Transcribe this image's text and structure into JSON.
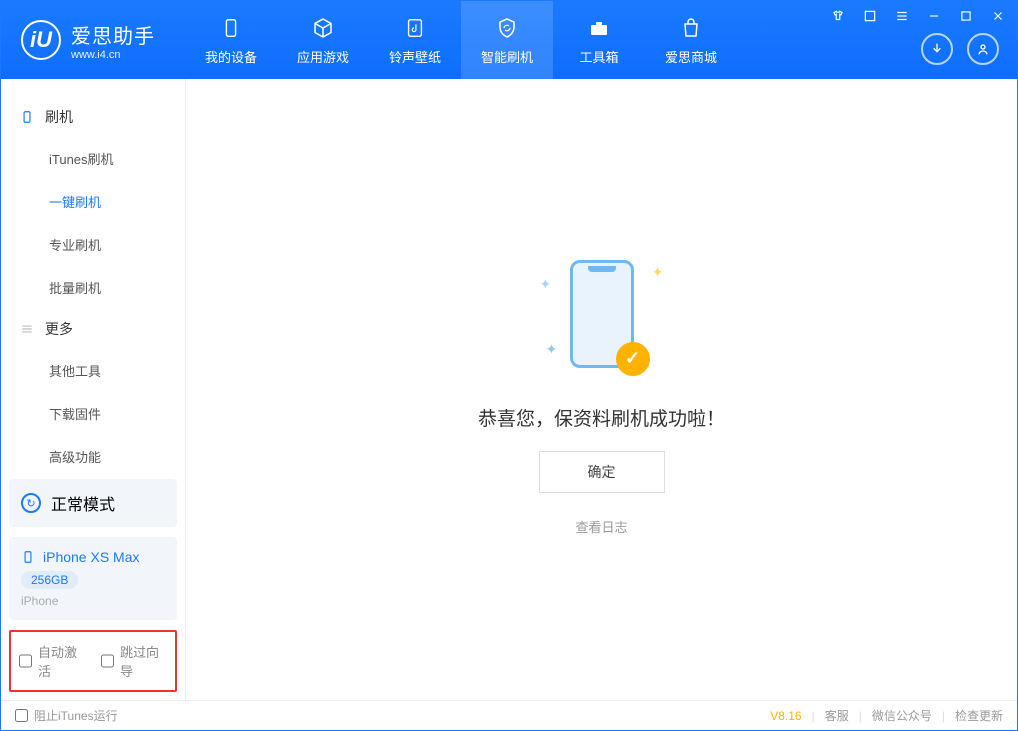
{
  "app": {
    "name": "爱思助手",
    "url": "www.i4.cn"
  },
  "nav": {
    "tabs": [
      {
        "label": "我的设备"
      },
      {
        "label": "应用游戏"
      },
      {
        "label": "铃声壁纸"
      },
      {
        "label": "智能刷机"
      },
      {
        "label": "工具箱"
      },
      {
        "label": "爱思商城"
      }
    ],
    "active_index": 3
  },
  "sidebar": {
    "group1": {
      "title": "刷机",
      "items": [
        "iTunes刷机",
        "一键刷机",
        "专业刷机",
        "批量刷机"
      ],
      "active_index": 1
    },
    "group2": {
      "title": "更多",
      "items": [
        "其他工具",
        "下载固件",
        "高级功能"
      ]
    },
    "mode": {
      "label": "正常模式"
    },
    "device": {
      "name": "iPhone XS Max",
      "storage": "256GB",
      "type": "iPhone"
    },
    "checkboxes": {
      "auto_activate": "自动激活",
      "skip_guide": "跳过向导"
    }
  },
  "main": {
    "success_message": "恭喜您，保资料刷机成功啦！",
    "ok_button": "确定",
    "view_log": "查看日志"
  },
  "footer": {
    "block_itunes": "阻止iTunes运行",
    "version": "V8.16",
    "links": [
      "客服",
      "微信公众号",
      "检查更新"
    ]
  }
}
